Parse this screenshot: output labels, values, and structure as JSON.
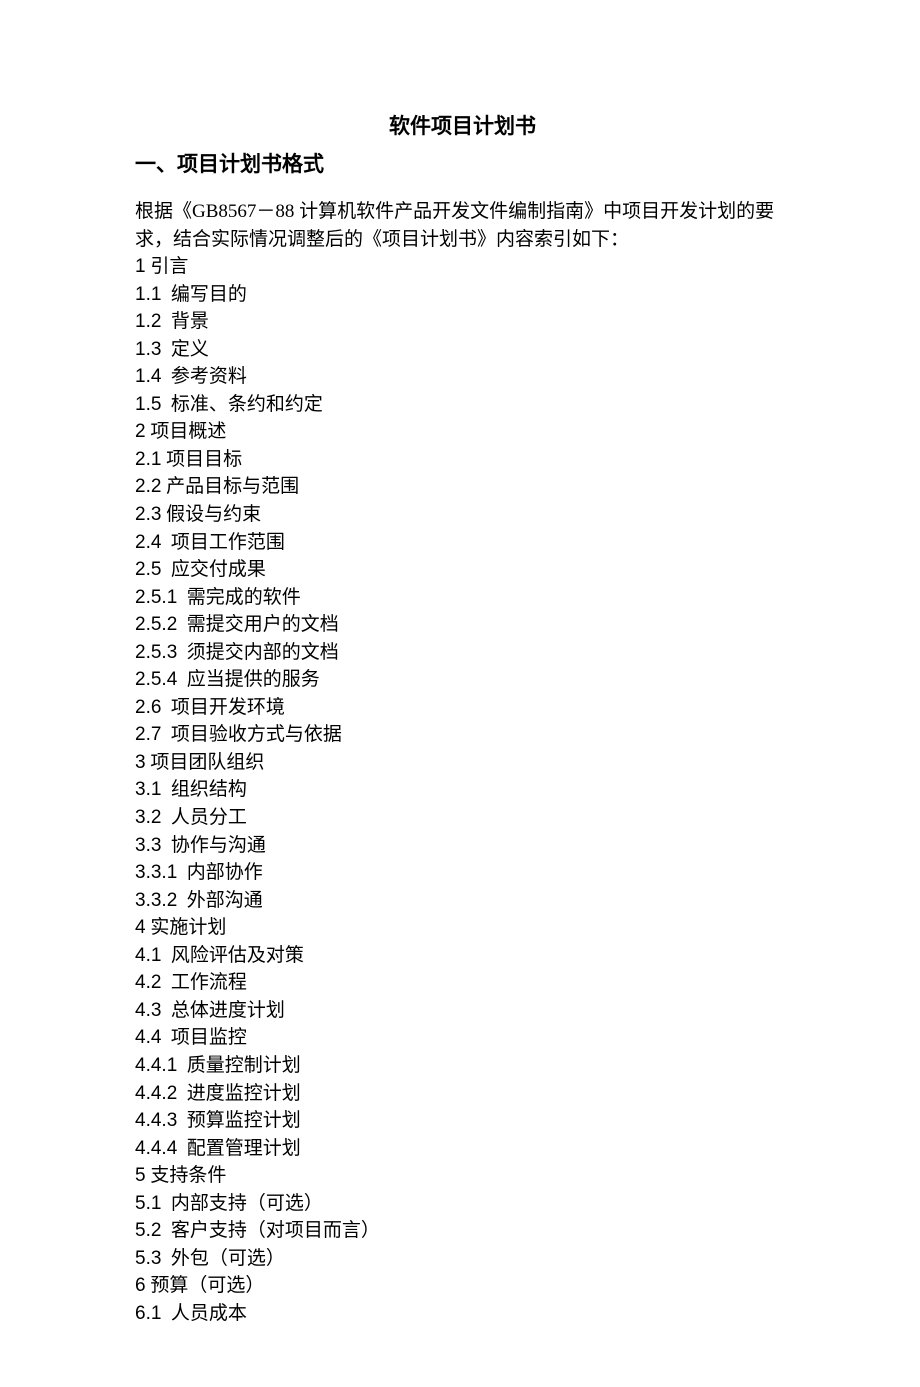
{
  "title": "软件项目计划书",
  "section_heading": "一、项目计划书格式",
  "intro": "根据《GB8567－88 计算机软件产品开发文件编制指南》中项目开发计划的要求，结合实际情况调整后的《项目计划书》内容索引如下：",
  "toc": [
    {
      "num": "1",
      "text": " 引言"
    },
    {
      "num": "1.1",
      "text": "  编写目的"
    },
    {
      "num": "1.2",
      "text": "  背景"
    },
    {
      "num": "1.3",
      "text": "  定义"
    },
    {
      "num": "1.4",
      "text": "  参考资料"
    },
    {
      "num": "1.5",
      "text": "  标准、条约和约定"
    },
    {
      "num": "2",
      "text": " 项目概述"
    },
    {
      "num": "2.1",
      "text": " 项目目标"
    },
    {
      "num": "2.2",
      "text": " 产品目标与范围"
    },
    {
      "num": "2.3",
      "text": " 假设与约束"
    },
    {
      "num": "2.4",
      "text": "  项目工作范围"
    },
    {
      "num": "2.5",
      "text": "  应交付成果"
    },
    {
      "num": "2.5.1",
      "text": "  需完成的软件"
    },
    {
      "num": "2.5.2",
      "text": "  需提交用户的文档"
    },
    {
      "num": "2.5.3",
      "text": "  须提交内部的文档"
    },
    {
      "num": "2.5.4",
      "text": "  应当提供的服务"
    },
    {
      "num": "2.6",
      "text": "  项目开发环境"
    },
    {
      "num": "2.7",
      "text": "  项目验收方式与依据"
    },
    {
      "num": "3",
      "text": " 项目团队组织"
    },
    {
      "num": "3.1",
      "text": "  组织结构"
    },
    {
      "num": "3.2",
      "text": "  人员分工"
    },
    {
      "num": "3.3",
      "text": "  协作与沟通"
    },
    {
      "num": "3.3.1",
      "text": "  内部协作"
    },
    {
      "num": "3.3.2",
      "text": "  外部沟通"
    },
    {
      "num": "4",
      "text": " 实施计划"
    },
    {
      "num": "4.1",
      "text": "  风险评估及对策"
    },
    {
      "num": "4.2",
      "text": "  工作流程"
    },
    {
      "num": "4.3",
      "text": "  总体进度计划"
    },
    {
      "num": "4.4",
      "text": "  项目监控"
    },
    {
      "num": "4.4.1",
      "text": "  质量控制计划"
    },
    {
      "num": "4.4.2",
      "text": "  进度监控计划"
    },
    {
      "num": "4.4.3",
      "text": "  预算监控计划"
    },
    {
      "num": "4.4.4",
      "text": "  配置管理计划"
    },
    {
      "num": "5",
      "text": " 支持条件"
    },
    {
      "num": "5.1",
      "text": "  内部支持（可选）"
    },
    {
      "num": "5.2",
      "text": "  客户支持（对项目而言）"
    },
    {
      "num": "5.3",
      "text": "  外包（可选）"
    },
    {
      "num": "6",
      "text": " 预算（可选）"
    },
    {
      "num": "6.1",
      "text": "  人员成本"
    }
  ]
}
